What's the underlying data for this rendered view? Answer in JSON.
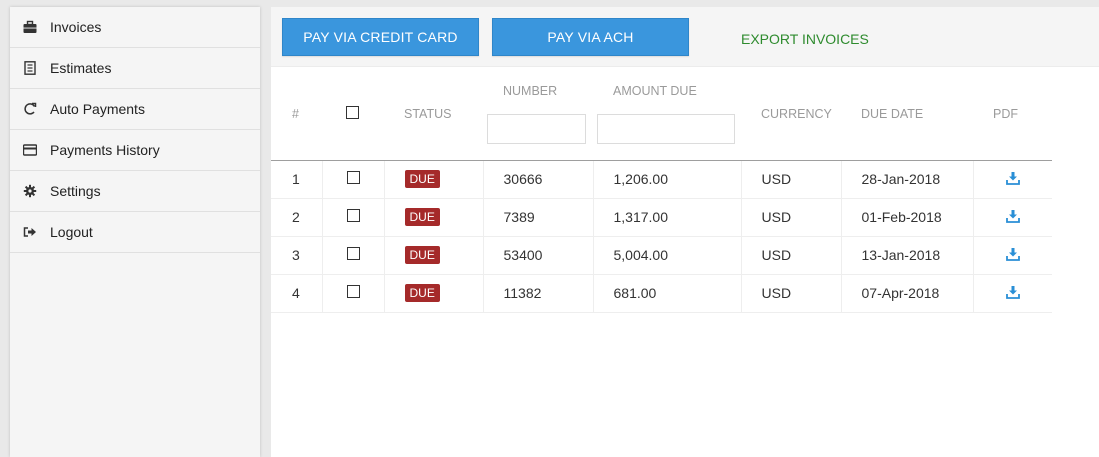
{
  "sidebar": {
    "items": [
      {
        "label": "Invoices",
        "icon": "briefcase-icon"
      },
      {
        "label": "Estimates",
        "icon": "document-icon"
      },
      {
        "label": "Auto Payments",
        "icon": "sync-icon"
      },
      {
        "label": "Payments History",
        "icon": "credit-card-icon"
      },
      {
        "label": "Settings",
        "icon": "gear-icon"
      },
      {
        "label": "Logout",
        "icon": "logout-icon"
      }
    ]
  },
  "toolbar": {
    "pay_credit_card": "PAY VIA CREDIT CARD",
    "pay_ach": "PAY VIA ACH",
    "export": "EXPORT INVOICES"
  },
  "table": {
    "headers": {
      "index": "#",
      "status": "STATUS",
      "number": "NUMBER",
      "amount_due": "AMOUNT DUE",
      "currency": "CURRENCY",
      "due_date": "DUE DATE",
      "pdf": "PDF"
    },
    "filters": {
      "number": "",
      "amount_due": ""
    },
    "rows": [
      {
        "index": "1",
        "status": "DUE",
        "number": "30666",
        "amount": "1,206.00",
        "currency": "USD",
        "due_date": "28-Jan-2018"
      },
      {
        "index": "2",
        "status": "DUE",
        "number": "7389",
        "amount": "1,317.00",
        "currency": "USD",
        "due_date": "01-Feb-2018"
      },
      {
        "index": "3",
        "status": "DUE",
        "number": "53400",
        "amount": "5,004.00",
        "currency": "USD",
        "due_date": "13-Jan-2018"
      },
      {
        "index": "4",
        "status": "DUE",
        "number": "11382",
        "amount": "681.00",
        "currency": "USD",
        "due_date": "07-Apr-2018"
      }
    ]
  },
  "colors": {
    "primary_button": "#3a96dd",
    "export_link": "#2e8b2e",
    "due_badge": "#a52a2a",
    "download_icon": "#2a8fd6"
  }
}
